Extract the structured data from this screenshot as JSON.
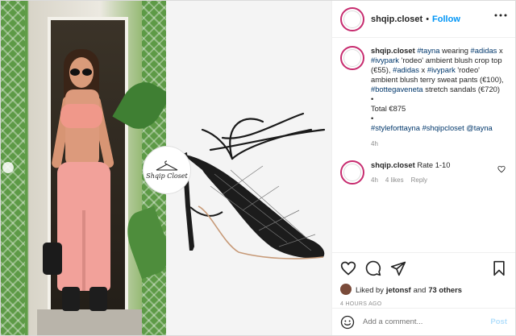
{
  "post": {
    "username": "shqip.closet",
    "follow_label": "Follow",
    "separator": "•",
    "logo_text": "Shqip Closet"
  },
  "caption": {
    "username": "shqip.closet",
    "segments": [
      {
        "text": "#tayna",
        "tag": true
      },
      {
        "text": " wearing ",
        "tag": false
      },
      {
        "text": "#adidas",
        "tag": true
      },
      {
        "text": " x ",
        "tag": false
      },
      {
        "text": "#ivypark",
        "tag": true
      },
      {
        "text": " 'rodeo' ambient blush crop top (€55), ",
        "tag": false
      },
      {
        "text": "#adidas",
        "tag": true
      },
      {
        "text": " x ",
        "tag": false
      },
      {
        "text": "#ivypark",
        "tag": true
      },
      {
        "text": " 'rodeo' ambient blush terry sweat pants (€100), ",
        "tag": false
      },
      {
        "text": "#bottegaveneta",
        "tag": true
      },
      {
        "text": " stretch sandals (€720)",
        "tag": false
      }
    ],
    "bullet1": "•",
    "total": "Total €875",
    "bullet2": "•",
    "hashtags": "#styleforttayna #shqipcloset @tayna",
    "time": "4h"
  },
  "comment": {
    "username": "shqip.closet",
    "text": "Rate 1-10",
    "time": "4h",
    "likes": "4 likes",
    "reply": "Reply"
  },
  "likes": {
    "prefix": "Liked by ",
    "user": "jetonsf",
    "middle": " and ",
    "others": "73 others"
  },
  "timestamp": "4 HOURS AGO",
  "comment_input": {
    "placeholder": "Add a comment...",
    "post_label": "Post"
  },
  "icons": {
    "like": "heart-icon",
    "comment": "comment-icon",
    "share": "share-icon",
    "save": "bookmark-icon",
    "emoji": "smiley-icon",
    "more": "more-options-icon"
  },
  "colors": {
    "accent": "#0095f6",
    "tag": "#00376b",
    "muted": "#8e8e8e",
    "story_ring": "#c72c6f"
  }
}
